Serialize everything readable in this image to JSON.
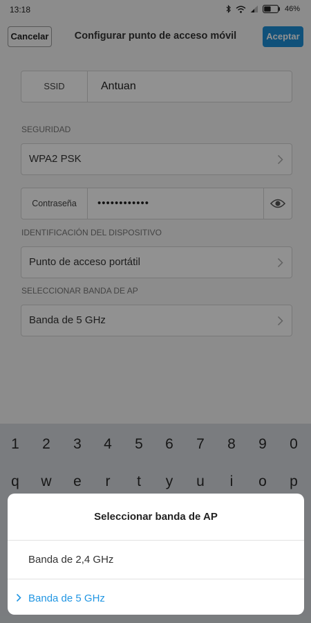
{
  "status": {
    "time": "13:18",
    "battery": "46%"
  },
  "header": {
    "cancel_label": "Cancelar",
    "title": "Configurar punto de acceso móvil",
    "accept_label": "Aceptar"
  },
  "form": {
    "ssid": {
      "label": "SSID",
      "value": "Antuan"
    },
    "security": {
      "section_label": "SEGURIDAD",
      "value": "WPA2 PSK"
    },
    "password": {
      "label": "Contraseña",
      "value": "••••••••••••"
    },
    "device_id": {
      "section_label": "IDENTIFICACIÓN DEL DISPOSITIVO",
      "value": "Punto de acceso portátil"
    },
    "band": {
      "section_label": "SELECCIONAR BANDA DE AP",
      "value": "Banda de 5 GHz"
    }
  },
  "keyboard": {
    "numbers": [
      "1",
      "2",
      "3",
      "4",
      "5",
      "6",
      "7",
      "8",
      "9",
      "0"
    ],
    "letters": [
      "q",
      "w",
      "e",
      "r",
      "t",
      "y",
      "u",
      "i",
      "o",
      "p"
    ]
  },
  "sheet": {
    "title": "Seleccionar banda de AP",
    "options": [
      {
        "label": "Banda de 2,4 GHz",
        "selected": false
      },
      {
        "label": "Banda de 5 GHz",
        "selected": true
      }
    ]
  },
  "colors": {
    "accent": "#1d8fd6",
    "selected": "#2196e3"
  }
}
